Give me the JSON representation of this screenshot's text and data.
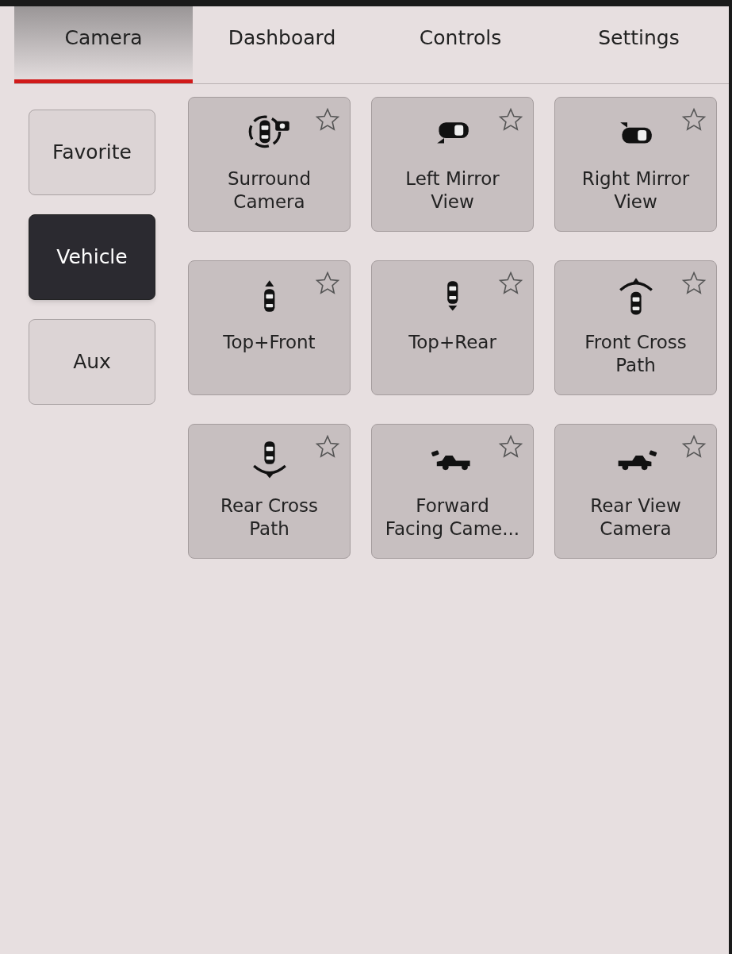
{
  "tabs": [
    {
      "label": "Camera",
      "selected": true
    },
    {
      "label": "Dashboard",
      "selected": false
    },
    {
      "label": "Controls",
      "selected": false
    },
    {
      "label": "Settings",
      "selected": false
    }
  ],
  "categories": [
    {
      "label": "Favorite",
      "selected": false
    },
    {
      "label": "Vehicle",
      "selected": true
    },
    {
      "label": "Aux",
      "selected": false
    }
  ],
  "tiles": [
    {
      "label": "Surround\nCamera",
      "kind": "surround",
      "favorite": false
    },
    {
      "label": "Left Mirror\nView",
      "kind": "left-mirror",
      "favorite": false
    },
    {
      "label": "Right Mirror\nView",
      "kind": "right-mirror",
      "favorite": false
    },
    {
      "label": "Top+Front",
      "kind": "top-front",
      "favorite": false
    },
    {
      "label": "Top+Rear",
      "kind": "top-rear",
      "favorite": false
    },
    {
      "label": "Front Cross\nPath",
      "kind": "front-cross",
      "favorite": false
    },
    {
      "label": "Rear Cross\nPath",
      "kind": "rear-cross",
      "favorite": false
    },
    {
      "label": "Forward\nFacing Came...",
      "kind": "forward-facing",
      "favorite": false
    },
    {
      "label": "Rear View\nCamera",
      "kind": "rear-view",
      "favorite": false
    }
  ]
}
